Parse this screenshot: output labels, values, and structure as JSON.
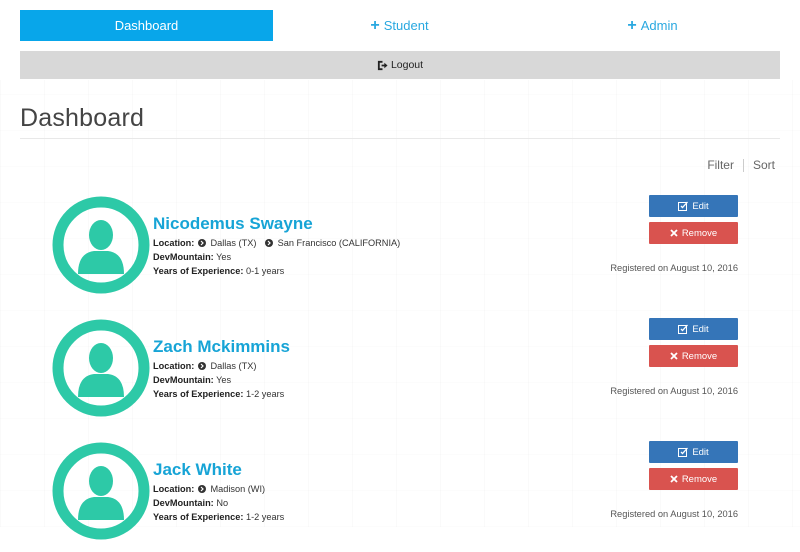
{
  "nav": {
    "tabs": [
      {
        "label": "Dashboard",
        "active": true
      },
      {
        "label": "Student",
        "icon": "plus-icon"
      },
      {
        "label": "Admin",
        "icon": "plus-icon"
      }
    ],
    "logout_label": "Logout"
  },
  "page": {
    "title": "Dashboard",
    "filter_label": "Filter",
    "sort_label": "Sort"
  },
  "labels": {
    "location": "Location:",
    "devmountain": "DevMountain:",
    "experience": "Years of Experience:",
    "edit": "Edit",
    "remove": "Remove"
  },
  "students": [
    {
      "name": "Nicodemus Swayne",
      "locations": [
        "Dallas (TX)",
        "San Francisco (CALIFORNIA)"
      ],
      "devmountain": "Yes",
      "experience": "0-1 years",
      "registered": "Registered on August 10, 2016"
    },
    {
      "name": "Zach Mckimmins",
      "locations": [
        "Dallas (TX)"
      ],
      "devmountain": "Yes",
      "experience": "1-2 years",
      "registered": "Registered on August 10, 2016"
    },
    {
      "name": "Jack White",
      "locations": [
        "Madison (WI)"
      ],
      "devmountain": "No",
      "experience": "1-2 years",
      "registered": "Registered on August 10, 2016"
    }
  ],
  "colors": {
    "primary": "#08a6ea",
    "avatar": "#2dc9a7",
    "edit": "#3575b8",
    "remove": "#d9534f"
  }
}
